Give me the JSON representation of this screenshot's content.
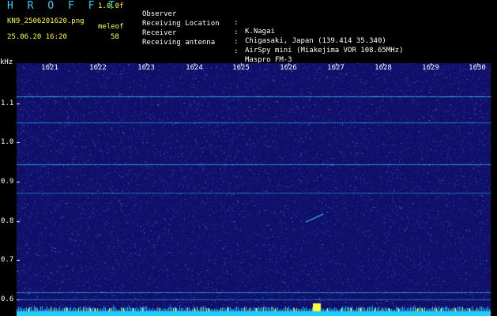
{
  "header": {
    "logo": "H R O F F T",
    "version": "1.0.0f",
    "filename": "KN9_2506201620.png",
    "software": "meleof",
    "datetime": "25.06.20 16:20",
    "count": "58"
  },
  "info": [
    {
      "label": "Observer",
      "value": "K.Nagai"
    },
    {
      "label": "Receiving Location",
      "value": "Chigasaki, Japan (139.414 35.340)"
    },
    {
      "label": "Receiver",
      "value": "AirSpy mini (Miakejima VOR 108.65MHz)"
    },
    {
      "label": "Receiving antenna",
      "value": "Maspro FM-3"
    }
  ],
  "axis": {
    "y_unit": "kHz",
    "y_ticks": [
      "1.1",
      "1.0",
      "0.9",
      "0.8",
      "0.7",
      "0.6"
    ],
    "time_ticks": [
      "1621",
      "1622",
      "1623",
      "1624",
      "1625",
      "1626",
      "1627",
      "1628",
      "1629",
      "1630"
    ]
  },
  "colors": {
    "background": "#10106a",
    "noise": "#3344cc",
    "signal": "#33ddff",
    "power_bar": "#22ccff",
    "power_spike": "#ffff33",
    "label_cyan": "#33ccff",
    "label_yellow": "#ffff33"
  }
}
